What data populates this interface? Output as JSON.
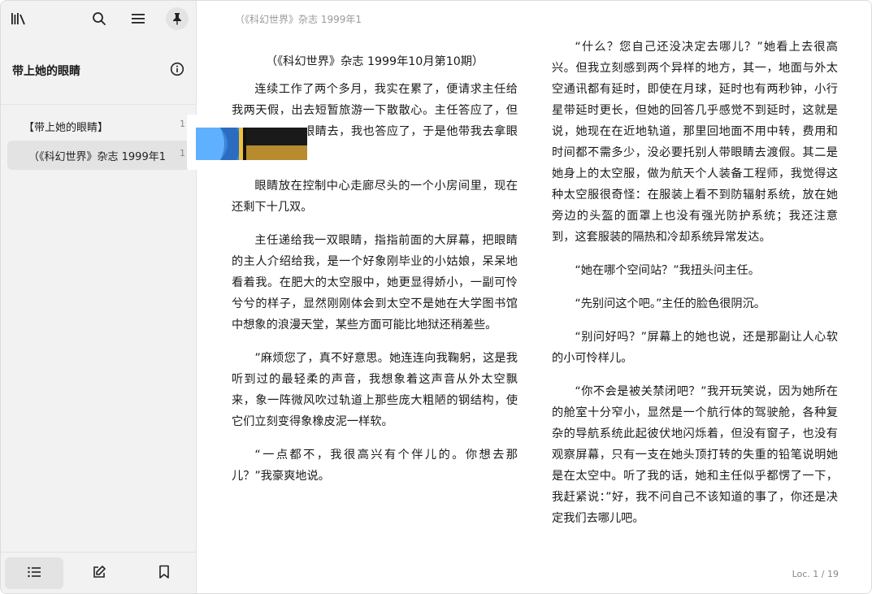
{
  "toolbar": {
    "library_icon": "library-icon",
    "search_icon": "search-icon",
    "menu_icon": "menu-icon",
    "pin_icon": "pin-icon"
  },
  "book": {
    "title": "带上她的眼睛",
    "info_icon": "info-icon"
  },
  "toc": {
    "items": [
      {
        "label": "【带上她的眼睛】",
        "page": "1"
      },
      {
        "label": "（《科幻世界》杂志 1999年1",
        "page": "1"
      }
    ]
  },
  "bottom": {
    "toc_icon": "list-icon",
    "notes_icon": "edit-icon",
    "bookmarks_icon": "bookmark-icon"
  },
  "reader": {
    "running_head": "（《科幻世界》杂志 1999年1",
    "location": "Loc. 1 / 19",
    "left_heading": "（《科幻世界》杂志 1999年10月第10期）",
    "left_paragraphs": [
      "连续工作了两个多月，我实在累了，便请求主任给我两天假，出去短暂旅游一下散散心。主任答应了，但要我再带一双眼睛去，我也答应了，于是他带我去拿眼睛。",
      "眼睛放在控制中心走廊尽头的一个小房间里，现在还剩下十几双。",
      "主任递给我一双眼睛，指指前面的大屏幕，把眼睛的主人介绍给我，是一个好象刚毕业的小姑娘，呆呆地看着我。在肥大的太空服中，她更显得娇小，一副可怜兮兮的样子，显然刚刚体会到太空不是她在大学图书馆中想象的浪漫天堂，某些方面可能比地狱还稍差些。",
      "”麻烦您了，真不好意思。她连连向我鞠躬，这是我听到过的最轻柔的声音，我想象着这声音从外太空飘来，象一阵微风吹过轨道上那些庞大粗陋的钢结构，使它们立刻变得象橡皮泥一样软。",
      "“一点都不，我很高兴有个伴儿的。你想去那儿？”我豪爽地说。"
    ],
    "right_paragraphs": [
      "“什么？您自己还没决定去哪儿？”她看上去很高兴。但我立刻感到两个异样的地方，其一，地面与外太空通讯都有延时，即使在月球，延时也有两秒钟，小行星带延时更长，但她的回答几乎感觉不到延时，这就是说，她现在在近地轨道，那里回地面不用中转，费用和时间都不需多少，没必要托别人带眼睛去渡假。其二是她身上的太空服，做为航天个人装备工程师，我觉得这种太空服很奇怪：在服装上看不到防辐射系统，放在她旁边的头盔的面罩上也没有强光防护系统；我还注意到，这套服装的隔热和冷却系统异常发达。",
      "“她在哪个空间站？”我扭头问主任。",
      "“先别问这个吧。”主任的脸色很阴沉。",
      "“别问好吗？”屏幕上的她也说，还是那副让人心软的小可怜样儿。",
      "“你不会是被关禁闭吧？”我开玩笑说，因为她所在的舱室十分窄小，显然是一个航行体的驾驶舱，各种复杂的导航系统此起彼伏地闪烁着，但没有窗子，也没有观察屏幕，只有一支在她头顶打转的失重的铅笔说明她是在太空中。听了我的话，她和主任似乎都愣了一下，我赶紧说：”好，我不问自己不该知道的事了，你还是决定我们去哪儿吧。"
    ]
  }
}
